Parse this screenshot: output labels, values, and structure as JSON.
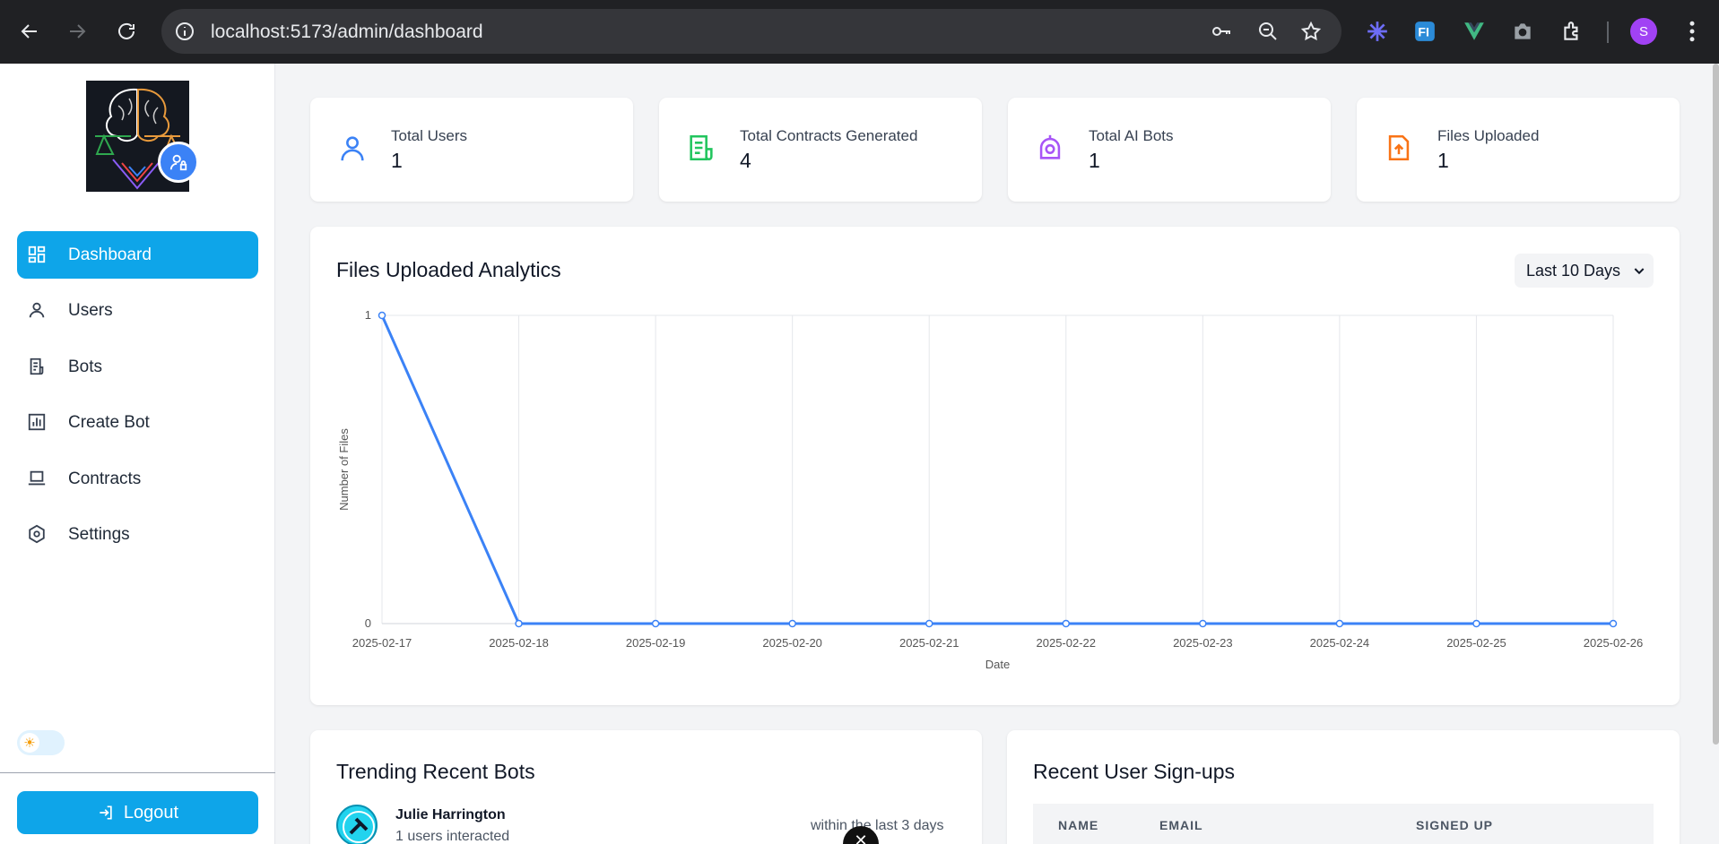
{
  "browser": {
    "url": "localhost:5173/admin/dashboard",
    "profile_initial": "S"
  },
  "sidebar": {
    "items": [
      {
        "label": "Dashboard",
        "icon": "dashboard-icon"
      },
      {
        "label": "Users",
        "icon": "user-icon"
      },
      {
        "label": "Bots",
        "icon": "bots-icon"
      },
      {
        "label": "Create Bot",
        "icon": "chart-icon"
      },
      {
        "label": "Contracts",
        "icon": "laptop-icon"
      },
      {
        "label": "Settings",
        "icon": "settings-icon"
      }
    ],
    "logout_label": "Logout"
  },
  "stats": [
    {
      "label": "Total Users",
      "value": "1",
      "icon": "user-icon",
      "color": "#3b82f6"
    },
    {
      "label": "Total Contracts Generated",
      "value": "4",
      "icon": "document-icon",
      "color": "#22c55e"
    },
    {
      "label": "Total AI Bots",
      "value": "1",
      "icon": "bot-icon",
      "color": "#a855f7"
    },
    {
      "label": "Files Uploaded",
      "value": "1",
      "icon": "file-upload-icon",
      "color": "#f97316"
    }
  ],
  "analytics": {
    "title": "Files Uploaded Analytics",
    "range": "Last 10 Days"
  },
  "chart_data": {
    "type": "line",
    "x": [
      "2025-02-17",
      "2025-02-18",
      "2025-02-19",
      "2025-02-20",
      "2025-02-21",
      "2025-02-22",
      "2025-02-23",
      "2025-02-24",
      "2025-02-25",
      "2025-02-26"
    ],
    "series": [
      {
        "values": [
          1,
          0,
          0,
          0,
          0,
          0,
          0,
          0,
          0,
          0
        ],
        "color": "#3b82f6"
      }
    ],
    "xlabel": "Date",
    "ylabel": "Number of Files",
    "ylim": [
      0,
      1
    ],
    "yticks": [
      "0",
      "1"
    ],
    "grid": true
  },
  "trending": {
    "title": "Trending Recent Bots",
    "items": [
      {
        "name": "Julie Harrington",
        "sub": "1 users interacted",
        "time": "within the last 3 days"
      }
    ]
  },
  "signups": {
    "title": "Recent User Sign-ups",
    "columns": [
      "NAME",
      "EMAIL",
      "SIGNED UP"
    ]
  }
}
